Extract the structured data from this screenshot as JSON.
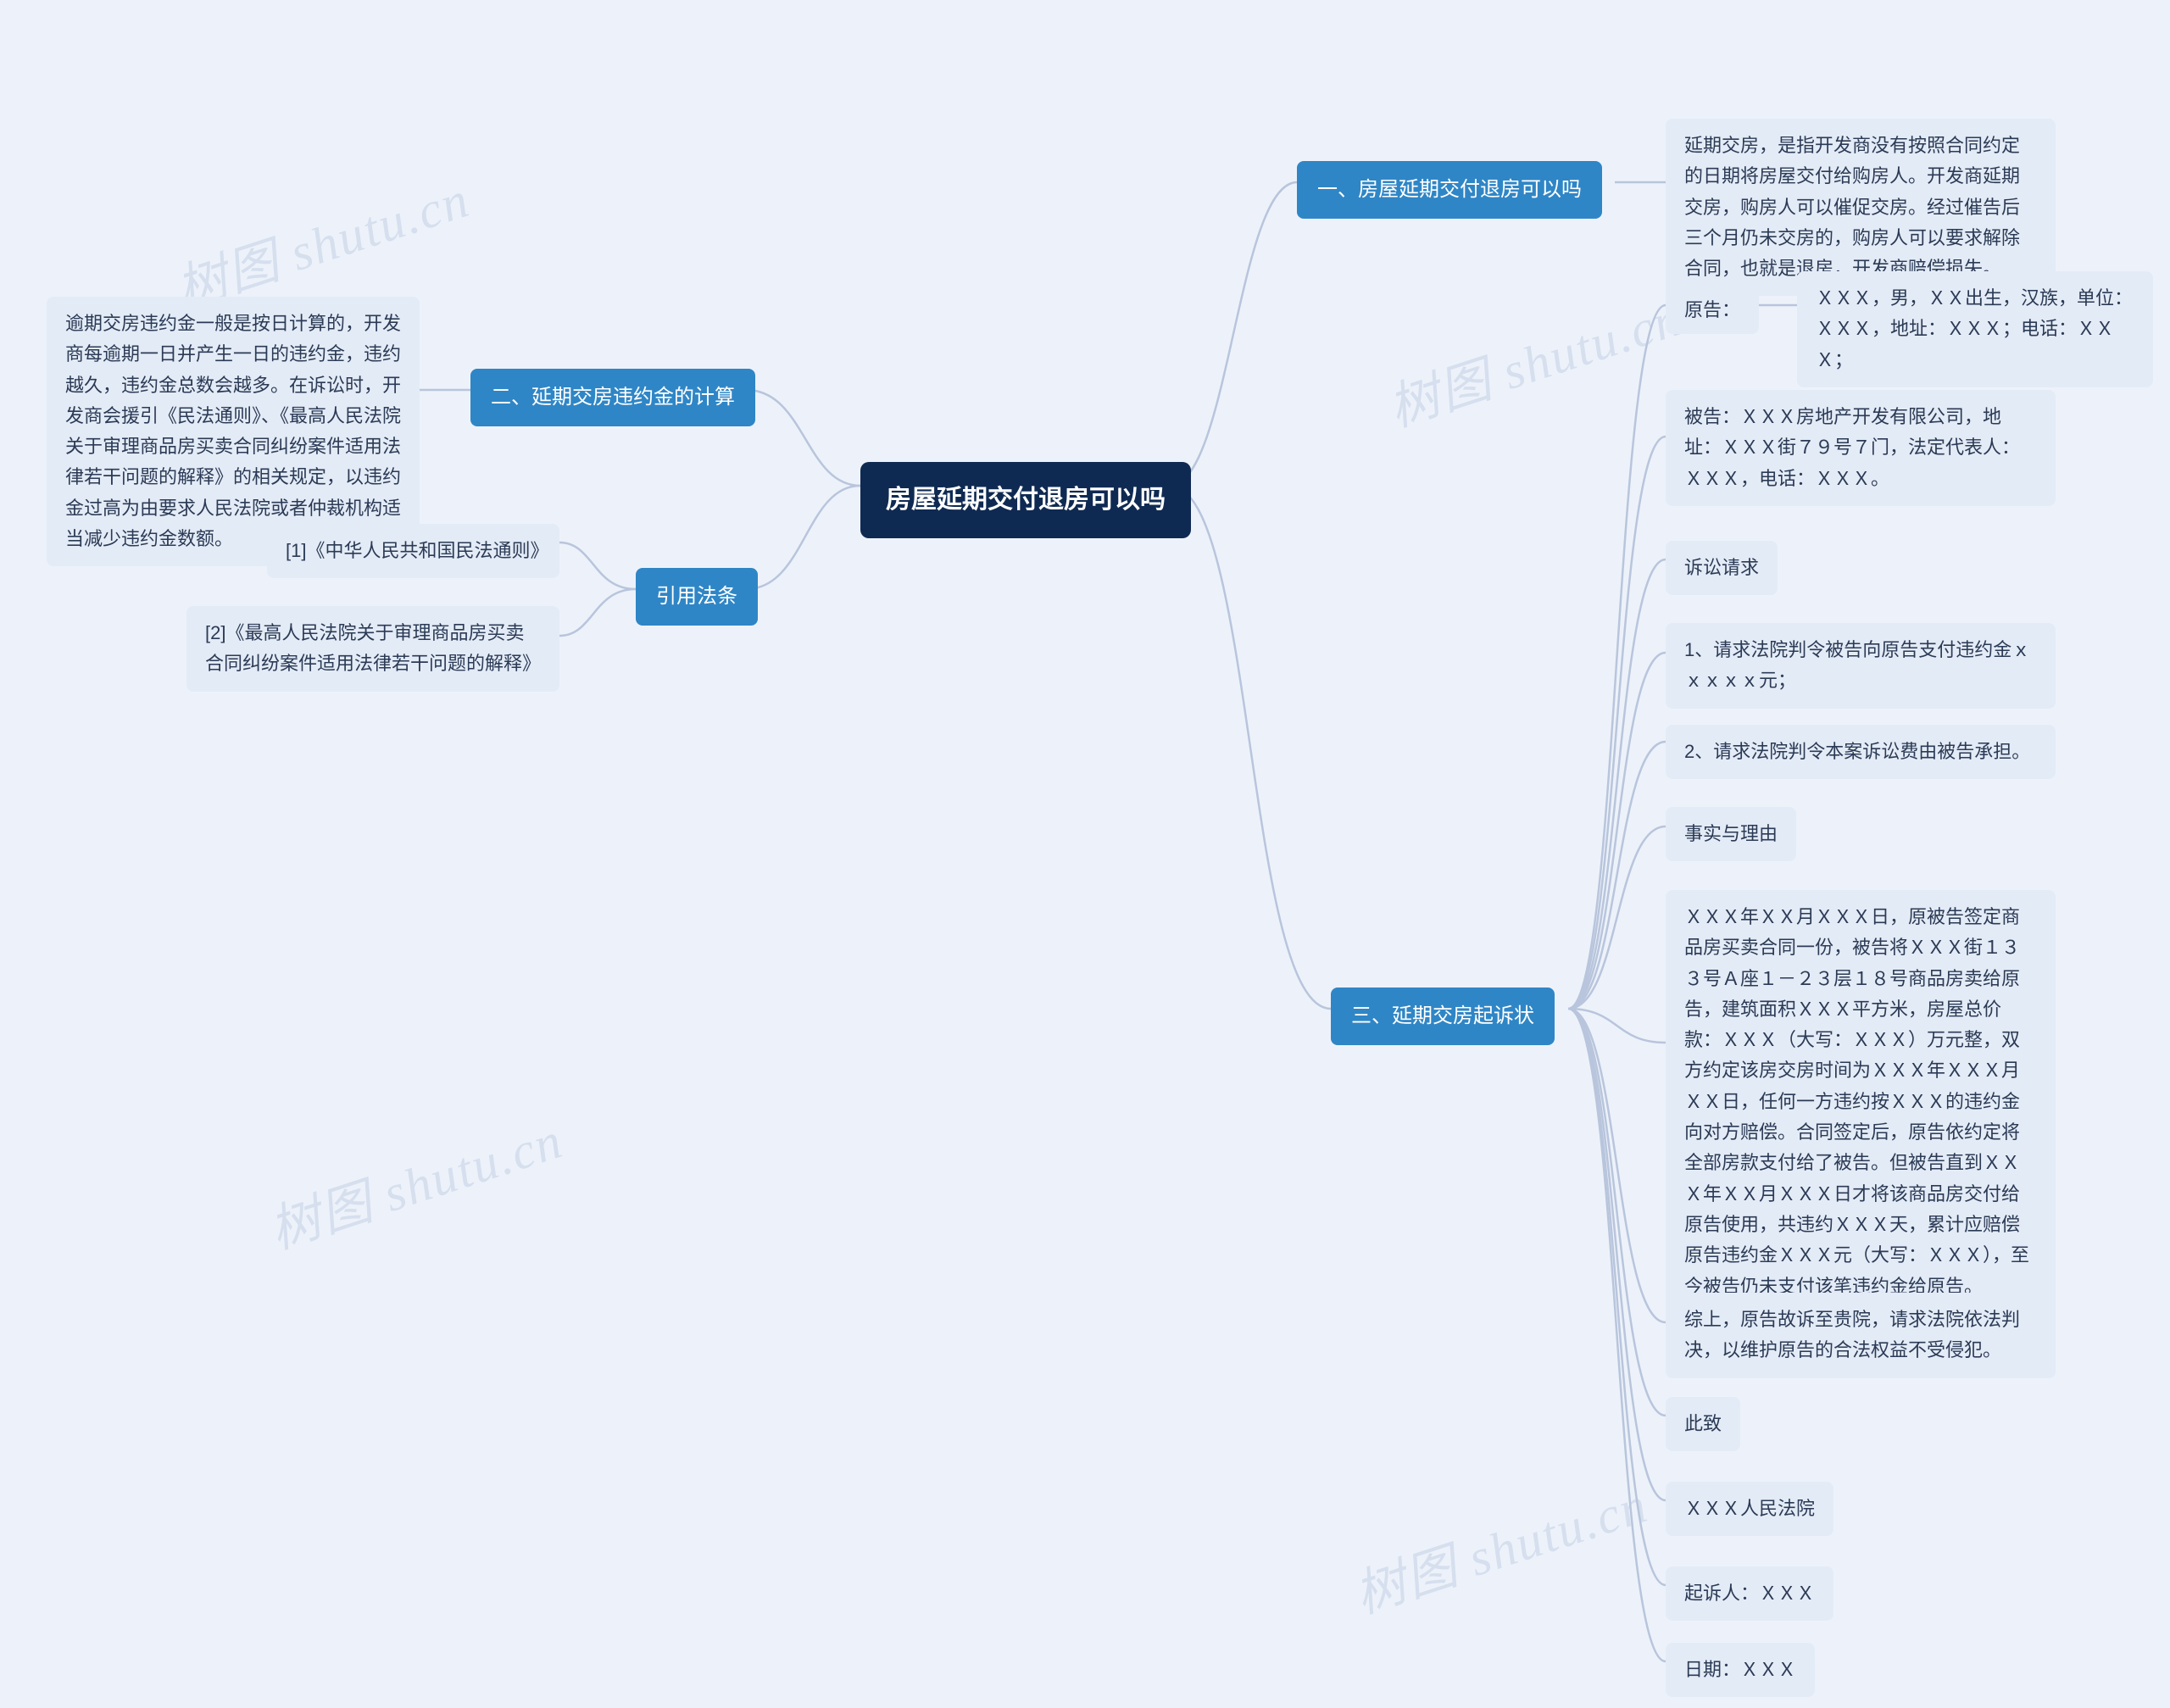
{
  "root": "房屋延期交付退房可以吗",
  "branches": {
    "s1": "一、房屋延期交付退房可以吗",
    "s2": "二、延期交房违约金的计算",
    "s3": "三、延期交房起诉状",
    "ref": "引用法条"
  },
  "leaves": {
    "s1_1": "延期交房，是指开发商没有按照合同约定的日期将房屋交付给购房人。开发商延期交房，购房人可以催促交房。经过催告后三个月仍未交房的，购房人可以要求解除合同，也就是退房，开发商赔偿损失。",
    "s2_1": "逾期交房违约金一般是按日计算的，开发商每逾期一日并产生一日的违约金，违约越久，违约金总数会越多。在诉讼时，开发商会援引《民法通则》、《最高人民法院关于审理商品房买卖合同纠纷案件适用法律若干问题的解释》的相关规定，以违约金过高为由要求人民法院或者仲裁机构适当减少违约金数额。",
    "ref_1": "[1]《中华人民共和国民法通则》",
    "ref_2": "[2]《最高人民法院关于审理商品房买卖合同纠纷案件适用法律若干问题的解释》",
    "s3_label_plaintiff": "原告：",
    "s3_plaintiff": "ＸＸＸ，男，ＸＸ出生，汉族，单位：ＸＸＸ，地址：ＸＸＸ；电话：ＸＸＸ；",
    "s3_defendant": "被告：ＸＸＸ房地产开发有限公司，地址：ＸＸＸ街７９号７门，法定代表人：ＸＸＸ，电话：ＸＸＸ。",
    "s3_req_h": "诉讼请求",
    "s3_req_1": "1、请求法院判令被告向原告支付违约金ｘｘｘｘｘ元；",
    "s3_req_2": "2、请求法院判令本案诉讼费由被告承担。",
    "s3_facts_h": "事实与理由",
    "s3_facts_1": "ＸＸＸ年ＸＸ月ＸＸＸ日，原被告签定商品房买卖合同一份，被告将ＸＸＸ街１３３号Ａ座１－２３层１８号商品房卖给原告，建筑面积ＸＸＸ平方米，房屋总价款：ＸＸＸ（大写：ＸＸＸ）万元整，双方约定该房交房时间为ＸＸＸ年ＸＸＸ月ＸＸ日，任何一方违约按ＸＸＸ的违约金向对方赔偿。合同签定后，原告依约定将全部房款支付给了被告。但被告直到ＸＸＸ年ＸＸ月ＸＸＸ日才将该商品房交付给原告使用，共违约ＸＸＸ天，累计应赔偿原告违约金ＸＸＸ元（大写：ＸＸＸ），至今被告仍未支付该笔违约金给原告。",
    "s3_facts_2": "综上，原告故诉至贵院，请求法院依法判决，以维护原告的合法权益不受侵犯。",
    "s3_close_1": "此致",
    "s3_close_2": "ＸＸＸ人民法院",
    "s3_sign": "起诉人：ＸＸＸ",
    "s3_date": "日期：ＸＸＸ"
  },
  "watermark": "树图 shutu.cn"
}
